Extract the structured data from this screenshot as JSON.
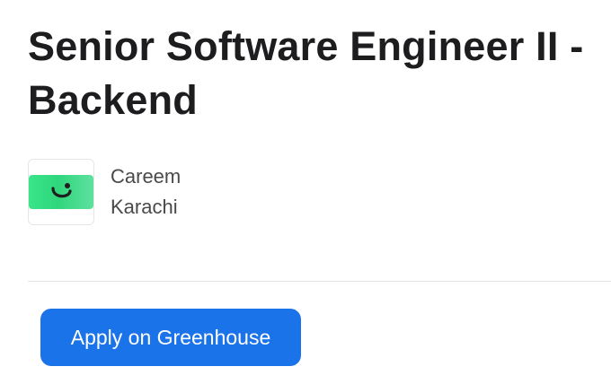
{
  "job": {
    "title": "Senior Software Engineer II - Backend"
  },
  "company": {
    "name": "Careem",
    "location": "Karachi",
    "logo_icon": "careem-smile-icon",
    "logo_color": "#2fd67c"
  },
  "actions": {
    "apply_label": "Apply on Greenhouse",
    "apply_color": "#1a73e8"
  }
}
